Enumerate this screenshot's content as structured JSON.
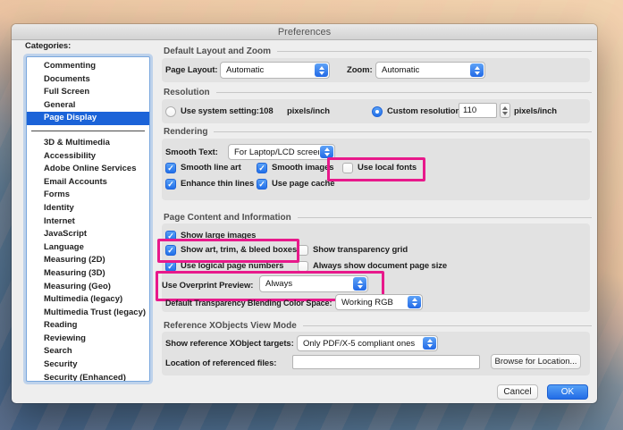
{
  "window": {
    "title": "Preferences"
  },
  "colors": {
    "accent_blue": "#2270e9",
    "selection_blue": "#1b63d8",
    "highlight_pink": "#e8198b"
  },
  "sidebar": {
    "label": "Categories:",
    "selected": "Page Display",
    "separator_after_index": 4,
    "items": [
      "Commenting",
      "Documents",
      "Full Screen",
      "General",
      "Page Display",
      "3D & Multimedia",
      "Accessibility",
      "Adobe Online Services",
      "Email Accounts",
      "Forms",
      "Identity",
      "Internet",
      "JavaScript",
      "Language",
      "Measuring (2D)",
      "Measuring (3D)",
      "Measuring (Geo)",
      "Multimedia (legacy)",
      "Multimedia Trust (legacy)",
      "Reading",
      "Reviewing",
      "Search",
      "Security",
      "Security (Enhanced)"
    ]
  },
  "layout_zoom": {
    "title": "Default Layout and Zoom",
    "page_layout_label": "Page Layout:",
    "page_layout_value": "Automatic",
    "zoom_label": "Zoom:",
    "zoom_value": "Automatic"
  },
  "resolution": {
    "title": "Resolution",
    "system": {
      "label": "Use system setting:",
      "value": "108",
      "unit": "pixels/inch",
      "selected": false
    },
    "custom": {
      "label": "Custom resolution:",
      "value": "110",
      "unit": "pixels/inch",
      "selected": true
    }
  },
  "rendering": {
    "title": "Rendering",
    "smooth_text_label": "Smooth Text:",
    "smooth_text_value": "For Laptop/LCD screens",
    "smooth_line_art": {
      "label": "Smooth line art",
      "checked": true
    },
    "smooth_images": {
      "label": "Smooth images",
      "checked": true
    },
    "use_local_fonts": {
      "label": "Use local fonts",
      "checked": false
    },
    "enhance_thin_lines": {
      "label": "Enhance thin lines",
      "checked": true
    },
    "use_page_cache": {
      "label": "Use page cache",
      "checked": true
    }
  },
  "page_content": {
    "title": "Page Content and Information",
    "show_large_images": {
      "label": "Show large images",
      "checked": true
    },
    "show_art_trim_bleed": {
      "label": "Show art, trim, & bleed boxes",
      "checked": true
    },
    "show_transparency_grid": {
      "label": "Show transparency grid",
      "checked": false
    },
    "use_logical_page_numbers": {
      "label": "Use logical page numbers",
      "checked": true
    },
    "always_show_page_size": {
      "label": "Always show document page size",
      "checked": false
    },
    "overprint_label": "Use Overprint Preview:",
    "overprint_value": "Always",
    "blend_label": "Default Transparency Blending Color Space:",
    "blend_value": "Working RGB"
  },
  "xobjects": {
    "title": "Reference XObjects View Mode",
    "targets_label": "Show reference XObject targets:",
    "targets_value": "Only PDF/X-5 compliant ones",
    "location_label": "Location of referenced files:",
    "location_value": "",
    "browse_label": "Browse for Location..."
  },
  "footer": {
    "cancel_label": "Cancel",
    "ok_label": "OK"
  }
}
